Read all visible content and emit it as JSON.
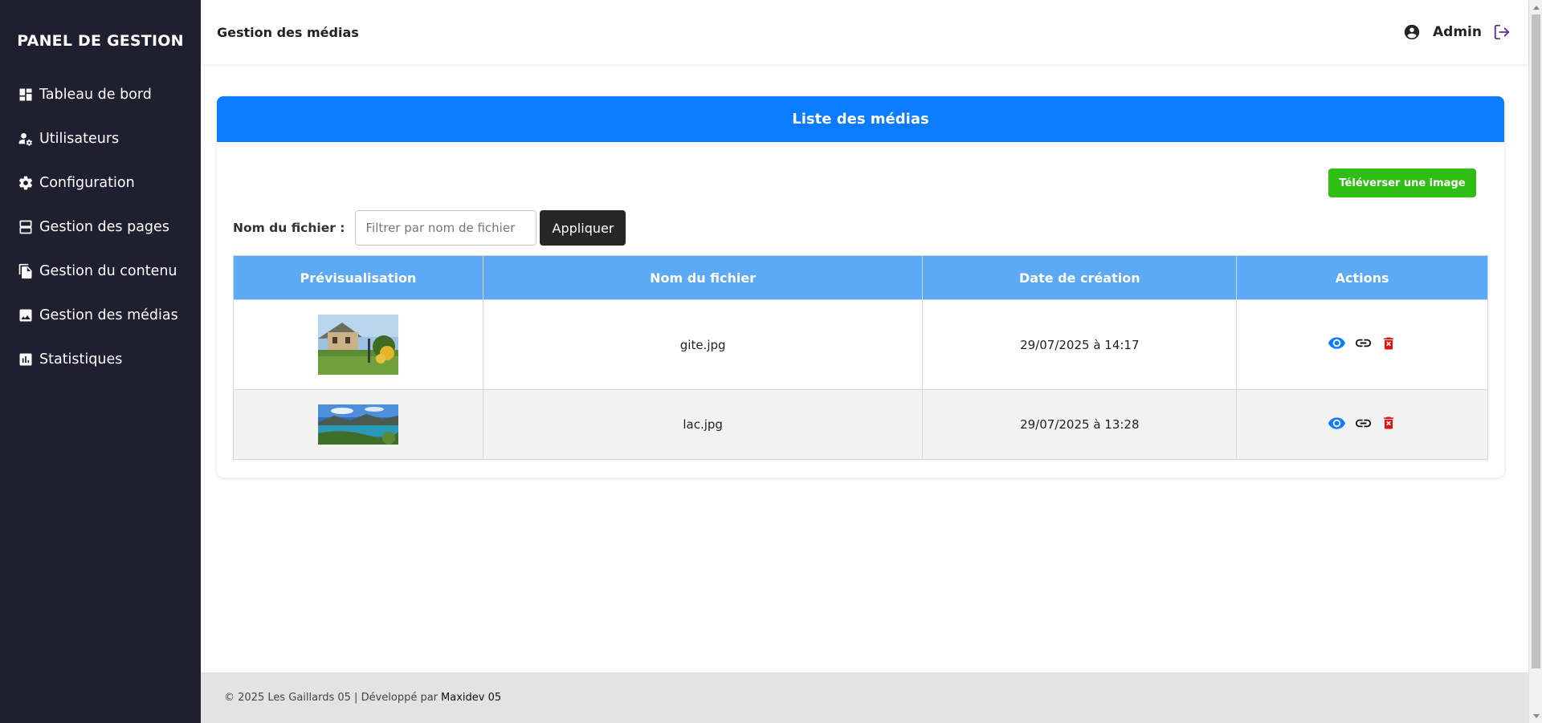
{
  "sidebar": {
    "title": "PANEL DE GESTION",
    "items": [
      {
        "label": "Tableau de bord",
        "icon": "dashboard-icon"
      },
      {
        "label": "Utilisateurs",
        "icon": "users-settings-icon"
      },
      {
        "label": "Configuration",
        "icon": "gear-icon"
      },
      {
        "label": "Gestion des pages",
        "icon": "pages-icon"
      },
      {
        "label": "Gestion du contenu",
        "icon": "document-icon"
      },
      {
        "label": "Gestion des médias",
        "icon": "image-icon"
      },
      {
        "label": "Statistiques",
        "icon": "bar-chart-icon"
      }
    ]
  },
  "header": {
    "title": "Gestion des médias",
    "user": "Admin"
  },
  "card": {
    "title": "Liste des médias",
    "upload_label": "Téléverser une image",
    "filter_label": "Nom du fichier :",
    "filter_placeholder": "Filtrer par nom de fichier",
    "filter_value": "",
    "apply_label": "Appliquer"
  },
  "table": {
    "headers": [
      "Prévisualisation",
      "Nom du fichier",
      "Date de création",
      "Actions"
    ],
    "rows": [
      {
        "filename": "gite.jpg",
        "date": "29/07/2025 à 14:17"
      },
      {
        "filename": "lac.jpg",
        "date": "29/07/2025 à 13:28"
      }
    ]
  },
  "footer": {
    "text": "© 2025 Les Gaillards 05 | Développé par",
    "link": "Maxidev 05"
  },
  "colors": {
    "sidebar_bg": "#1f1f30",
    "card_header": "#0b7cff",
    "table_header": "#5ca9f5",
    "upload_button": "#2fbf14",
    "apply_button": "#262626",
    "view_icon": "#0b7cff",
    "delete_icon": "#e01010",
    "logout_icon": "#5b2c9e"
  }
}
